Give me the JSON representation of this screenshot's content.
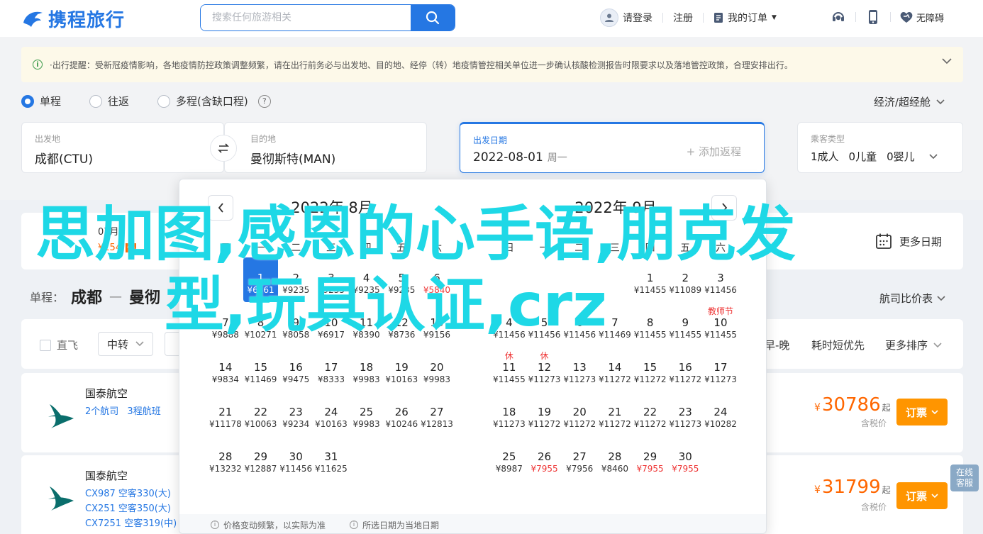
{
  "header": {
    "logo_text": "携程旅行",
    "search_placeholder": "搜索任何旅游相关",
    "login": "请登录",
    "register": "注册",
    "my_orders": "我的订单",
    "accessibility": "无障碍"
  },
  "notice": {
    "text": "·出行提醒：受新冠疫情影响，各地疫情防控政策调整频繁，请在出行前务必与出发地、目的地、经停（转）地疫情管控相关单位进一步确认核酸检测报告时限要求以及落地管控政策，合理安排出行。"
  },
  "trip_types": [
    "单程",
    "往返",
    "多程(含缺口程)"
  ],
  "cabin": "经济/超经舱",
  "form": {
    "from_label": "出发地",
    "from_value": "成都(CTU)",
    "to_label": "目的地",
    "to_value": "曼彻斯特(MAN)",
    "date_label": "出发日期",
    "date_value": "2022-08-01",
    "date_week": "周一",
    "add_return": "+ 添加返程",
    "passenger_label": "乘客类型",
    "adult": "1成人",
    "child": "0儿童",
    "infant": "0婴儿"
  },
  "date_strip": {
    "cell1_date": "07月",
    "cell1_price": "¥154",
    "cell1_tag": "低"
  },
  "more_dates": "更多日期",
  "route": {
    "prefix": "单程：",
    "from": "成都",
    "to": "曼彻"
  },
  "sort_label": "航司比价表",
  "filters": {
    "direct": "直飞",
    "transfer": "中转",
    "sort_time": "早-晚",
    "sort_short": "耗时短优先",
    "more_sort": "更多排序"
  },
  "flights": [
    {
      "airline": "国泰航空",
      "links": [
        "2个航司",
        "3程航班"
      ],
      "price": "30786",
      "tax": "含税价",
      "book": "订票"
    },
    {
      "airline": "国泰航空",
      "links": [
        "CX987 空客330(大)",
        "CX251 空客350(大)",
        "CX7251 空客319(中)"
      ],
      "price": "31799",
      "tax": "含税价",
      "book": "订票"
    }
  ],
  "side_float": "在线客服",
  "calendar": {
    "weekday_labels": [
      "日",
      "一",
      "二",
      "三",
      "四",
      "五",
      "六"
    ],
    "months": [
      {
        "title": "2022年 8月",
        "lead_blank": 1,
        "days": [
          {
            "d": "1",
            "p": "¥6361",
            "sel": true
          },
          {
            "d": "2",
            "p": "¥9235"
          },
          {
            "d": "3",
            "p": "¥9235"
          },
          {
            "d": "4",
            "p": "¥9235"
          },
          {
            "d": "5",
            "p": "¥9235"
          },
          {
            "d": "6",
            "p": "¥5840",
            "low": true
          },
          {
            "d": "7",
            "p": "¥9888"
          },
          {
            "d": "8",
            "p": "¥10271"
          },
          {
            "d": "9",
            "p": "¥8058"
          },
          {
            "d": "10",
            "p": "¥6917"
          },
          {
            "d": "11",
            "p": "¥8390"
          },
          {
            "d": "12",
            "p": "¥8736"
          },
          {
            "d": "13",
            "p": "¥9156"
          },
          {
            "d": "14",
            "p": "¥9834"
          },
          {
            "d": "15",
            "p": "¥11469"
          },
          {
            "d": "16",
            "p": "¥9475"
          },
          {
            "d": "17",
            "p": "¥8333"
          },
          {
            "d": "18",
            "p": "¥9983"
          },
          {
            "d": "19",
            "p": "¥10163"
          },
          {
            "d": "20",
            "p": "¥9983"
          },
          {
            "d": "21",
            "p": "¥11178"
          },
          {
            "d": "22",
            "p": "¥10063"
          },
          {
            "d": "23",
            "p": "¥9234"
          },
          {
            "d": "24",
            "p": "¥10163"
          },
          {
            "d": "25",
            "p": "¥9983"
          },
          {
            "d": "26",
            "p": "¥10246"
          },
          {
            "d": "27",
            "p": "¥12813"
          },
          {
            "d": "28",
            "p": "¥13232"
          },
          {
            "d": "29",
            "p": "¥12887"
          },
          {
            "d": "30",
            "p": "¥11456"
          },
          {
            "d": "31",
            "p": "¥11625"
          }
        ]
      },
      {
        "title": "2022年 9月",
        "lead_blank": 4,
        "days": [
          {
            "d": "1",
            "p": "¥11455"
          },
          {
            "d": "2",
            "p": "¥11089"
          },
          {
            "d": "3",
            "p": "¥11456"
          },
          {
            "d": "4",
            "p": "¥11456"
          },
          {
            "d": "5",
            "p": "¥11456"
          },
          {
            "d": "6",
            "p": "¥11456"
          },
          {
            "d": "7",
            "p": "¥11469"
          },
          {
            "d": "8",
            "p": "¥11455"
          },
          {
            "d": "9",
            "p": "¥11455"
          },
          {
            "d": "10",
            "p": "¥11455",
            "tag": "教师节"
          },
          {
            "d": "11",
            "p": "¥11455",
            "tag": "休"
          },
          {
            "d": "12",
            "p": "¥11273",
            "tag": "休"
          },
          {
            "d": "13",
            "p": "¥11273"
          },
          {
            "d": "14",
            "p": "¥11272"
          },
          {
            "d": "15",
            "p": "¥11272"
          },
          {
            "d": "16",
            "p": "¥11272"
          },
          {
            "d": "17",
            "p": "¥11273"
          },
          {
            "d": "18",
            "p": "¥11273"
          },
          {
            "d": "19",
            "p": "¥11272"
          },
          {
            "d": "20",
            "p": "¥11272"
          },
          {
            "d": "21",
            "p": "¥11272"
          },
          {
            "d": "22",
            "p": "¥11272"
          },
          {
            "d": "23",
            "p": "¥11273"
          },
          {
            "d": "24",
            "p": "¥10282"
          },
          {
            "d": "25",
            "p": "¥8987"
          },
          {
            "d": "26",
            "p": "¥7955",
            "low": true
          },
          {
            "d": "27",
            "p": "¥7956"
          },
          {
            "d": "28",
            "p": "¥8460"
          },
          {
            "d": "29",
            "p": "¥7955",
            "low": true
          },
          {
            "d": "30",
            "p": "¥7955",
            "low": true
          }
        ]
      }
    ],
    "footer": [
      "价格变动频繁，以实际为准",
      "所选日期为当地日期"
    ]
  },
  "overlay": {
    "line1": "思加图,感恩的心手语,朋克发",
    "line2": "型,玩具认证,crz"
  },
  "colors": {
    "brand": "#2577e3",
    "price": "#ff6600",
    "book": "#ff9500",
    "overlay": "#1ed8e6"
  }
}
